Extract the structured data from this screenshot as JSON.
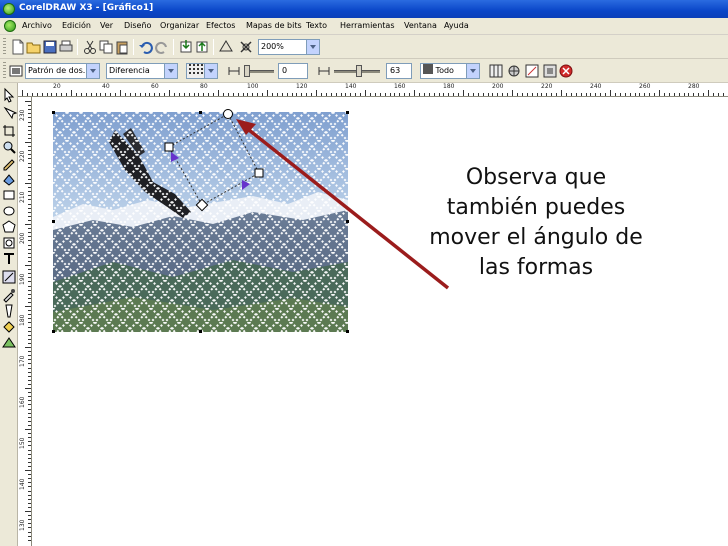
{
  "window": {
    "title": "CorelDRAW X3 - [Gráfico1]"
  },
  "menu": {
    "items": [
      "Archivo",
      "Edición",
      "Ver",
      "Diseño",
      "Organizar",
      "Efectos",
      "Mapas de bits",
      "Texto",
      "Herramientas",
      "Ventana",
      "Ayuda"
    ]
  },
  "toolbar1": {
    "zoom": "200%"
  },
  "toolbar2": {
    "pattern": "Patrón de dos...",
    "mode": "Diferencia",
    "transparency_start": "0",
    "transparency_end": "63",
    "apply_to": "Todo"
  },
  "ruler": {
    "h_labels": [
      "20",
      "40",
      "60",
      "80",
      "100",
      "120",
      "140",
      "160",
      "180",
      "200",
      "220",
      "240",
      "260",
      "280"
    ],
    "v_labels": [
      "230",
      "220",
      "210",
      "200",
      "190",
      "180",
      "170",
      "160",
      "150",
      "140",
      "130"
    ]
  },
  "callout": {
    "lines": [
      "Observa que",
      "también puedes",
      "mover el ángulo de",
      "las formas"
    ]
  },
  "colors": {
    "arrow": "#9b1c1c",
    "titlebar": "#0a46c8",
    "chrome": "#ece9d8",
    "transparency_handle": "#6633cc"
  },
  "icons": {
    "toolbar1": [
      "new-icon",
      "open-icon",
      "save-icon",
      "print-icon",
      "cut-icon",
      "copy-icon",
      "paste-icon",
      "undo-icon",
      "redo-icon",
      "import-icon",
      "export-icon",
      "app-launcher-icon",
      "welcome-icon"
    ],
    "toolbox": [
      "pick-tool-icon",
      "shape-tool-icon",
      "crop-tool-icon",
      "zoom-tool-icon",
      "freehand-tool-icon",
      "smart-fill-icon",
      "rectangle-tool-icon",
      "ellipse-tool-icon",
      "polygon-tool-icon",
      "basic-shapes-icon",
      "text-tool-icon",
      "interactive-tool-icon",
      "eyedropper-icon",
      "outline-tool-icon",
      "fill-tool-icon",
      "interactive-fill-icon"
    ]
  }
}
